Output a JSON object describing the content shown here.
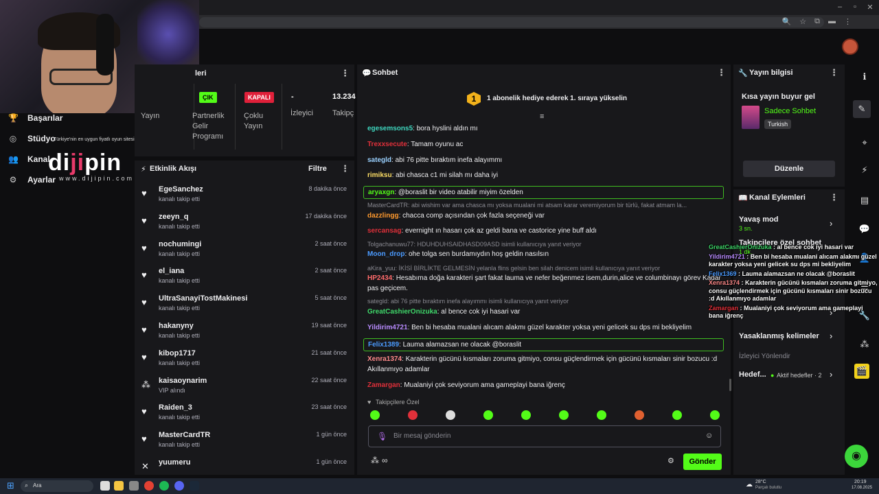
{
  "browser": {
    "window_controls": [
      "–",
      "▫",
      "✕"
    ],
    "toolbar_icons": [
      "🔍",
      "☆",
      "⧉",
      "▬",
      "⋮"
    ]
  },
  "brand": {
    "tagline": "Türkiye'nin en uygun fiyatlı oyun sitesi",
    "logo_left": "di",
    "logo_highlight": "ji",
    "logo_right": "pin",
    "url": "www.dijipin.com"
  },
  "sidebar": {
    "items": [
      {
        "icon": "🏆",
        "label": "Başarılar"
      },
      {
        "icon": "◎",
        "label": "Stüdyo"
      },
      {
        "icon": "👥",
        "label": "Kanal"
      },
      {
        "icon": "⚙",
        "label": "Ayarlar"
      }
    ]
  },
  "stats": {
    "title": "leri",
    "cells": [
      {
        "badge": "ÇIK",
        "label": "Yayın"
      },
      {
        "label": "Partnerlik Gelir Programı"
      },
      {
        "badge": "KAPALI",
        "label": "Çoklu Yayın"
      },
      {
        "value": "-",
        "label": "İzleyici"
      },
      {
        "value": "13.234",
        "label": "Takipç"
      }
    ]
  },
  "activity": {
    "title": "Etkinlik Akışı",
    "filter_label": "Filtre",
    "events": [
      {
        "name": "EgeSanchez",
        "sub": "kanalı takip etti",
        "time": "8 dakika önce",
        "icon": "♥"
      },
      {
        "name": "zeeyn_q",
        "sub": "kanalı takip etti",
        "time": "17 dakika önce",
        "icon": "♥"
      },
      {
        "name": "nochumingi",
        "sub": "kanalı takip etti",
        "time": "2 saat önce",
        "icon": "♥"
      },
      {
        "name": "el_iana",
        "sub": "kanalı takip etti",
        "time": "2 saat önce",
        "icon": "♥"
      },
      {
        "name": "UltraSanayiTostMakinesi",
        "sub": "kanalı takip etti",
        "time": "5 saat önce",
        "icon": "♥"
      },
      {
        "name": "hakanyny",
        "sub": "kanalı takip etti",
        "time": "19 saat önce",
        "icon": "♥"
      },
      {
        "name": "kibop1717",
        "sub": "kanalı takip etti",
        "time": "21 saat önce",
        "icon": "♥"
      },
      {
        "name": "kaisaoynarim",
        "sub": "VIP alındı",
        "time": "22 saat önce",
        "icon": "⁂"
      },
      {
        "name": "Raiden_3",
        "sub": "kanalı takip etti",
        "time": "23 saat önce",
        "icon": "♥"
      },
      {
        "name": "MasterCardTR",
        "sub": "kanalı takip etti",
        "time": "1 gün önce",
        "icon": "♥"
      },
      {
        "name": "yuumeru",
        "sub": "",
        "time": "1 gün önce",
        "icon": "✕"
      }
    ]
  },
  "chat": {
    "title": "Sohbet",
    "banner_number": "1",
    "banner_text": "1 abonelik hediye ederek 1. sıraya yükselin",
    "messages": [
      {
        "user": "egesemsons5",
        "color": "#3fd8c0",
        "text": ": bora hyslini aldın mı"
      },
      {
        "user": "Trexxsecute",
        "color": "#e0303a",
        "text": ": Tamam oyunu ac"
      },
      {
        "user": "sategld",
        "color": "#9ad1ff",
        "text": ": abi 76 pitte bıraktım inefa alayımmı"
      },
      {
        "user": "rimiksu",
        "color": "#ffe066",
        "text": ": abi chasca c1 mi silah mı daha iyi"
      },
      {
        "user": "aryaxgn",
        "color": "#53fc18",
        "text": ": @boraslit bir video atabilir miyim özelden"
      },
      {
        "reply": "MasterCardTR: abi wishim var ama chasca mı yoksa mualani mi atsam karar veremiyorum bir türlü, fakat atmam la..."
      },
      {
        "user": "dazzlingg",
        "color": "#ff9a2e",
        "text": ": chacca comp açısından çok fazla seçeneği var"
      },
      {
        "user": "sercansag",
        "color": "#e0303a",
        "text": ": evernight ın hasarı çok az geldi bana ve castorice yine buff aldı"
      },
      {
        "reply": "Tolgachanuwu77: HDUHDUHSAIDHASD09ASD isimli kullanıcıya yanıt veriyor"
      },
      {
        "user": "Moon_drop",
        "color": "#4b9bff",
        "text": ": ohe tolga sen burdamıydın hoş geldin nasılsın"
      },
      {
        "reply": "aKira_yuu: İKİSİ BİRLİKTE GELMESİN yelanla flins gelsin ben silah denicem isimli kullanıcıya yanıt veriyor"
      },
      {
        "user": "HP2434",
        "color": "#ff6b6b",
        "text": ": Hesabıma doğa karakteri şart fakat lauma ve nefer beğenmez isem,durin,alice ve columbinayı görev Kadar pas geçicem."
      },
      {
        "reply": "sategld: abi 76 pitte bıraktım inefa alayımmı isimli kullanıcıya yanıt veriyor"
      },
      {
        "user": "GreatCashierOnizuka",
        "color": "#3fd86a",
        "text": ": al bence cok iyi hasari var"
      },
      {
        "user": "Yildirim4721",
        "color": "#b98cff",
        "text": ": Ben bi hesaba mualani alıcam alakmı güzel karakter yoksa yeni gelicek su dps mi bekliyelim"
      },
      {
        "user": "Felix1389",
        "color": "#4b9bff",
        "text": ": Lauma alamazsan ne olacak @boraslit"
      },
      {
        "user": "Xenra1374",
        "color": "#ff8a8a",
        "text": ": Karakterin gücünü kısmaları zoruma gitmiyo, consu güçlendirmek için gücünü kısmaları sinir bozucu :d Akıllanmıyo adamlar"
      },
      {
        "user": "Zamargan",
        "color": "#e0303a",
        "text": ": Mualaniyi çok seviyorum ama gameplayi bana iğrenç"
      }
    ],
    "followers_only_label": "Takipçilere Özel",
    "input_placeholder": "Bir mesaj gönderin",
    "send_label": "Gönder",
    "footer_icon_label": "∞"
  },
  "info": {
    "title": "Yayın bilgisi",
    "stream_title": "Kısa yayın buyur gel",
    "category": "Sadece Sohbet",
    "language": "Turkish",
    "edit_label": "Düzenle"
  },
  "actions": {
    "title": "Kanal Eylemleri",
    "items": [
      {
        "label": "Yavaş mod",
        "sub": "3 sn."
      },
      {
        "label": "Takipçilere özel sohbet",
        "sub": "1 dk."
      },
      {
        "label": "Yasaklanmış kelimeler"
      }
    ],
    "section_label": "İzleyici Yönlendir",
    "target_label": "Hedef...",
    "target_status": "Aktif hedefler · 2"
  },
  "overlay": [
    {
      "user": "GreatCashierOnizuka",
      "color": "#3fd86a",
      "text": " : al bence cok iyi hasari var"
    },
    {
      "user": "Yildirim4721",
      "color": "#b98cff",
      "text": " : Ben bi hesaba mualani alıcam alakmı güzel karakter yoksa yeni gelicek su dps mi bekliyelim"
    },
    {
      "user": "Felix1369",
      "color": "#4b9bff",
      "text": " : Lauma alamazsan ne olacak @boraslit"
    },
    {
      "user": "Xenra1374",
      "color": "#ff8a8a",
      "text": " : Karakterin gücünü kısmaları zoruma gitmiyo, consu güçlendirmek için gücünü kısmaları sinir bozucu :d Akıllanmıyo adamlar"
    },
    {
      "user": "Zamargan",
      "color": "#e0303a",
      "text": " : Mualaniyi çok seviyorum ama gameplayi bana iğrenç"
    }
  ],
  "taskbar": {
    "search_label": "Ara",
    "weather": "28°C",
    "weather_sub": "Parçalı bulutlu",
    "time": "20:19",
    "date": "17.08.2025"
  }
}
